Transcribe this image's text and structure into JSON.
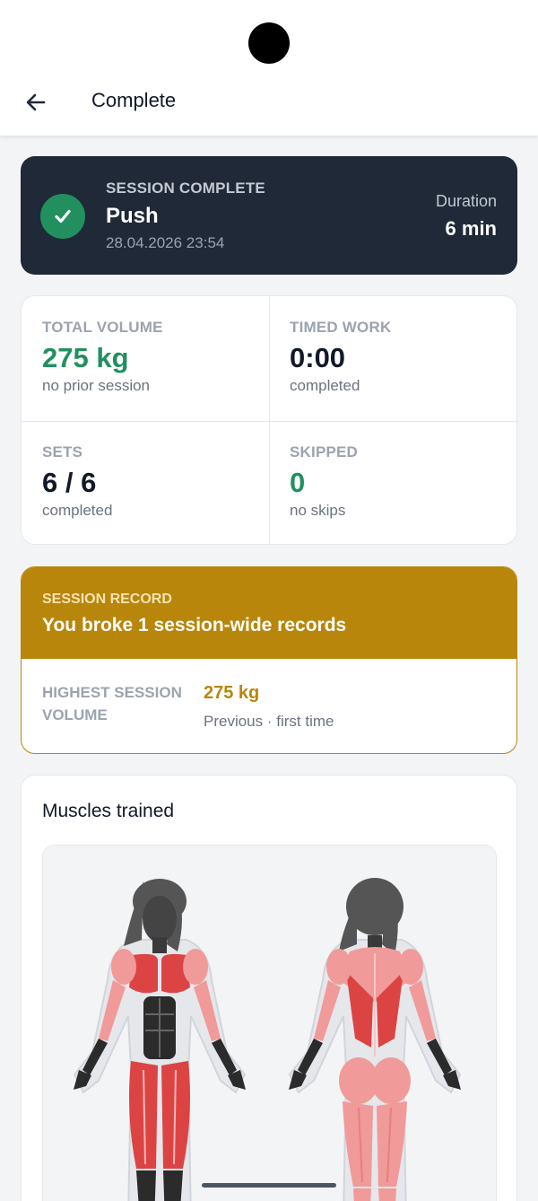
{
  "appbar": {
    "title": "Complete",
    "back_icon": "arrow-left-icon"
  },
  "session": {
    "kicker": "SESSION COMPLETE",
    "name": "Push",
    "datetime": "28.04.2026 23:54",
    "duration_label": "Duration",
    "duration_value": "6 min",
    "status_icon": "check-icon",
    "accent_color": "#22905e"
  },
  "stats": [
    {
      "label": "TOTAL VOLUME",
      "value": "275 kg",
      "sub": "no prior session",
      "value_color": "#22905e"
    },
    {
      "label": "TIMED WORK",
      "value": "0:00",
      "sub": "completed",
      "value_color": "#111827"
    },
    {
      "label": "SETS",
      "value": "6 / 6",
      "sub": "completed",
      "value_color": "#111827"
    },
    {
      "label": "SKIPPED",
      "value": "0",
      "sub": "no skips",
      "value_color": "#22905e"
    }
  ],
  "record": {
    "kicker": "SESSION RECORD",
    "title": "You broke 1 session-wide records",
    "item_label": "HIGHEST SESSION VOLUME",
    "item_value": "275 kg",
    "item_previous": "Previous · first time",
    "accent_color": "#b8860b"
  },
  "muscles": {
    "title": "Muscles trained",
    "front_trained": [
      "chest",
      "front-delts",
      "triceps",
      "quads"
    ],
    "back_trained": [
      "upper-back",
      "rear-delts",
      "glutes",
      "hamstrings",
      "calves"
    ],
    "trained_color": "#dc4444",
    "secondary_color": "#f09a9a",
    "untrained_color": "#2b2b2b"
  }
}
